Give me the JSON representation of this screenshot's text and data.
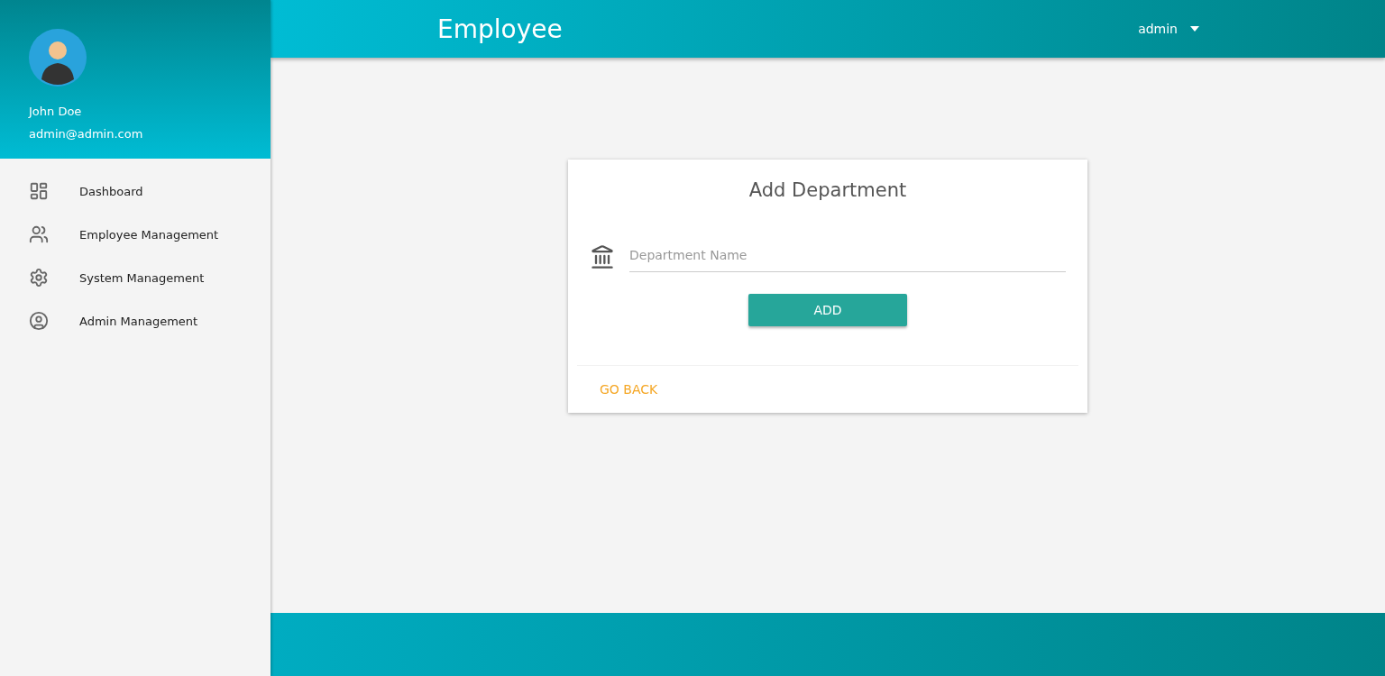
{
  "header": {
    "title": "Employee",
    "user_menu": "admin"
  },
  "sidebar": {
    "user": {
      "name": "John Doe",
      "email": "admin@admin.com"
    },
    "items": [
      {
        "label": "Dashboard",
        "selected": false
      },
      {
        "label": "Employee Management",
        "selected": false
      },
      {
        "label": "System Management",
        "selected": false
      },
      {
        "label": "Admin Management",
        "selected": false
      }
    ]
  },
  "card": {
    "title": "Add Department",
    "field": {
      "placeholder": "Department Name"
    },
    "submit": "ADD",
    "back": "GO BACK"
  }
}
